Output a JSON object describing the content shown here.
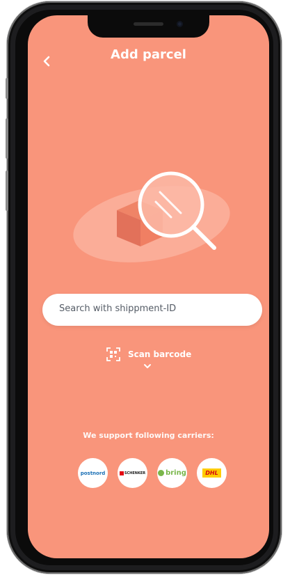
{
  "header": {
    "title": "Add parcel"
  },
  "search": {
    "placeholder": "Search with shippment-ID"
  },
  "scan": {
    "label": "Scan barcode"
  },
  "carriers": {
    "label": "We support following carriers:",
    "items": [
      {
        "name": "postnord",
        "text": "postnord"
      },
      {
        "name": "schenker",
        "text": "SCHENKER"
      },
      {
        "name": "bring",
        "text": "bring"
      },
      {
        "name": "dhl",
        "text": "DHL"
      }
    ]
  },
  "colors": {
    "background": "#f9957b",
    "accent": "#ffffff"
  }
}
